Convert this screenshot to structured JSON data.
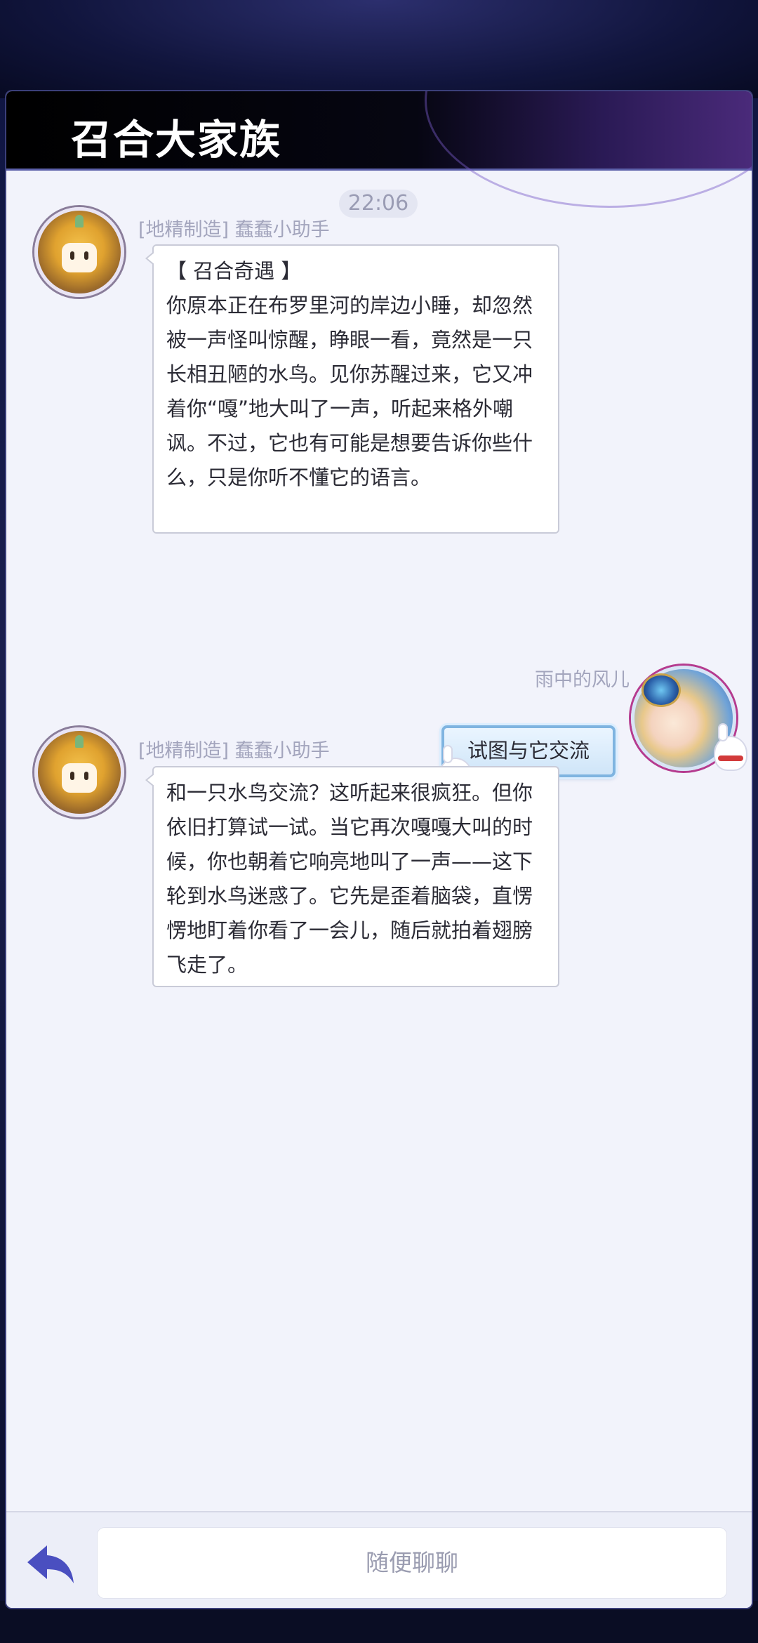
{
  "header": {
    "title": "召合大家族"
  },
  "chat": {
    "timestamp": "22:06",
    "messages": [
      {
        "sender": "[地精制造] 蠢蠢小助手",
        "text": "【 召合奇遇 】\n你原本正在布罗里河的岸边小睡，却忽然被一声怪叫惊醒，睁眼一看，竟然是一只长相丑陋的水鸟。见你苏醒过来，它又冲着你“嘎”地大叫了一声，听起来格外嘲讽。不过，它也有可能是想要告诉你些什么，只是你听不懂它的语言。"
      },
      {
        "sender": "雨中的风儿",
        "text": "试图与它交流"
      },
      {
        "sender": "[地精制造] 蠢蠢小助手",
        "text": "和一只水鸟交流？这听起来很疯狂。但你依旧打算试一试。当它再次嘎嘎大叫的时候，你也朝着它响亮地叫了一声——这下轮到水鸟迷惑了。它先是歪着脑袋，直愣愣地盯着你看了一会儿，随后就拍着翅膀飞走了。"
      }
    ]
  },
  "input": {
    "placeholder": "随便聊聊"
  },
  "icons": {
    "back": "back-arrow-icon"
  },
  "colors": {
    "accent": "#4a4fc0",
    "panel": "#f2f3fb",
    "header": "#000000"
  }
}
